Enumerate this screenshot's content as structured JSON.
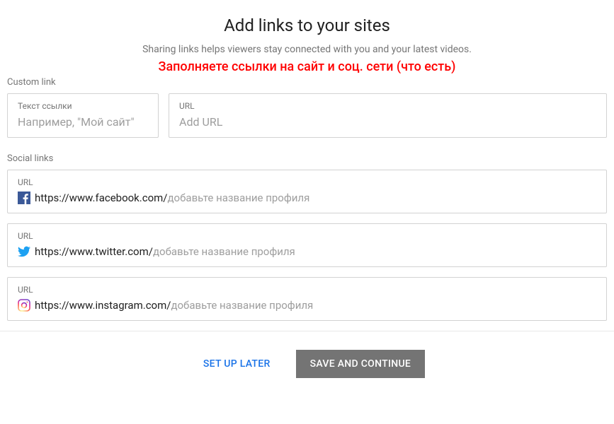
{
  "header": {
    "title": "Add links to your sites",
    "subtitle": "Sharing links helps viewers stay connected with you and your latest videos.",
    "annotation": "Заполняете ссылки на сайт и соц. сети (что есть)"
  },
  "custom_link": {
    "section_label": "Custom link",
    "text_label": "Текст ссылки",
    "text_placeholder": "Например, \"Мой сайт\"",
    "url_label": "URL",
    "url_placeholder": "Add URL"
  },
  "social": {
    "section_label": "Social links",
    "url_label": "URL",
    "hint": "добавьте название профиля",
    "items": [
      {
        "icon": "facebook",
        "base": "https://www.facebook.com/"
      },
      {
        "icon": "twitter",
        "base": "https://www.twitter.com/"
      },
      {
        "icon": "instagram",
        "base": "https://www.instagram.com/"
      }
    ]
  },
  "buttons": {
    "later": "SET UP LATER",
    "continue": "SAVE AND CONTINUE"
  }
}
